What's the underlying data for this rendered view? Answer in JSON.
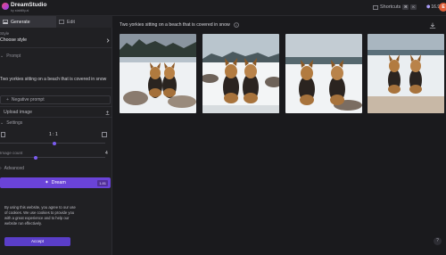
{
  "app": {
    "title": "DreamStudio",
    "subtitle": "by stability.ai"
  },
  "topbar": {
    "shortcuts_label": "Shortcuts",
    "key1": "⌘",
    "key2": "K",
    "credits": "16.9",
    "avatar_initial": "E"
  },
  "sidebar": {
    "tabs": [
      {
        "label": "Generate"
      },
      {
        "label": "Edit"
      }
    ],
    "style": {
      "section_label": "Style",
      "value": "Choose style"
    },
    "prompt": {
      "section_label": "Prompt",
      "text": "Two yorkies sitting on a beach that is covered in snow"
    },
    "negative_prompt": {
      "label": "Negative prompt"
    },
    "upload": {
      "label": "Upload image"
    },
    "settings": {
      "label": "Settings",
      "aspect_ratio": "1 : 1"
    },
    "image_count": {
      "label": "Image count",
      "value": "4"
    },
    "advanced": {
      "label": "Advanced"
    },
    "dream_button": {
      "label": "Dream",
      "cost": "1.81"
    }
  },
  "cookie": {
    "text": "By using this website, you agree to our use of cookies. We use cookies to provide you with a great experience and to help our website run effectively.",
    "accept_label": "Accept"
  },
  "main": {
    "prompt_title": "Two yorkies sitting on a beach that is covered in snow",
    "images": [
      {
        "alt": "two yorkies on snowy beach 1"
      },
      {
        "alt": "two yorkies on snowy beach 2"
      },
      {
        "alt": "two yorkies on snowy beach 3"
      },
      {
        "alt": "two yorkies on snowy beach 4"
      }
    ]
  },
  "help": {
    "label": "?"
  },
  "colors": {
    "accent": "#6a43d8",
    "background": "#1a1a1d",
    "sidebar": "#202023"
  }
}
